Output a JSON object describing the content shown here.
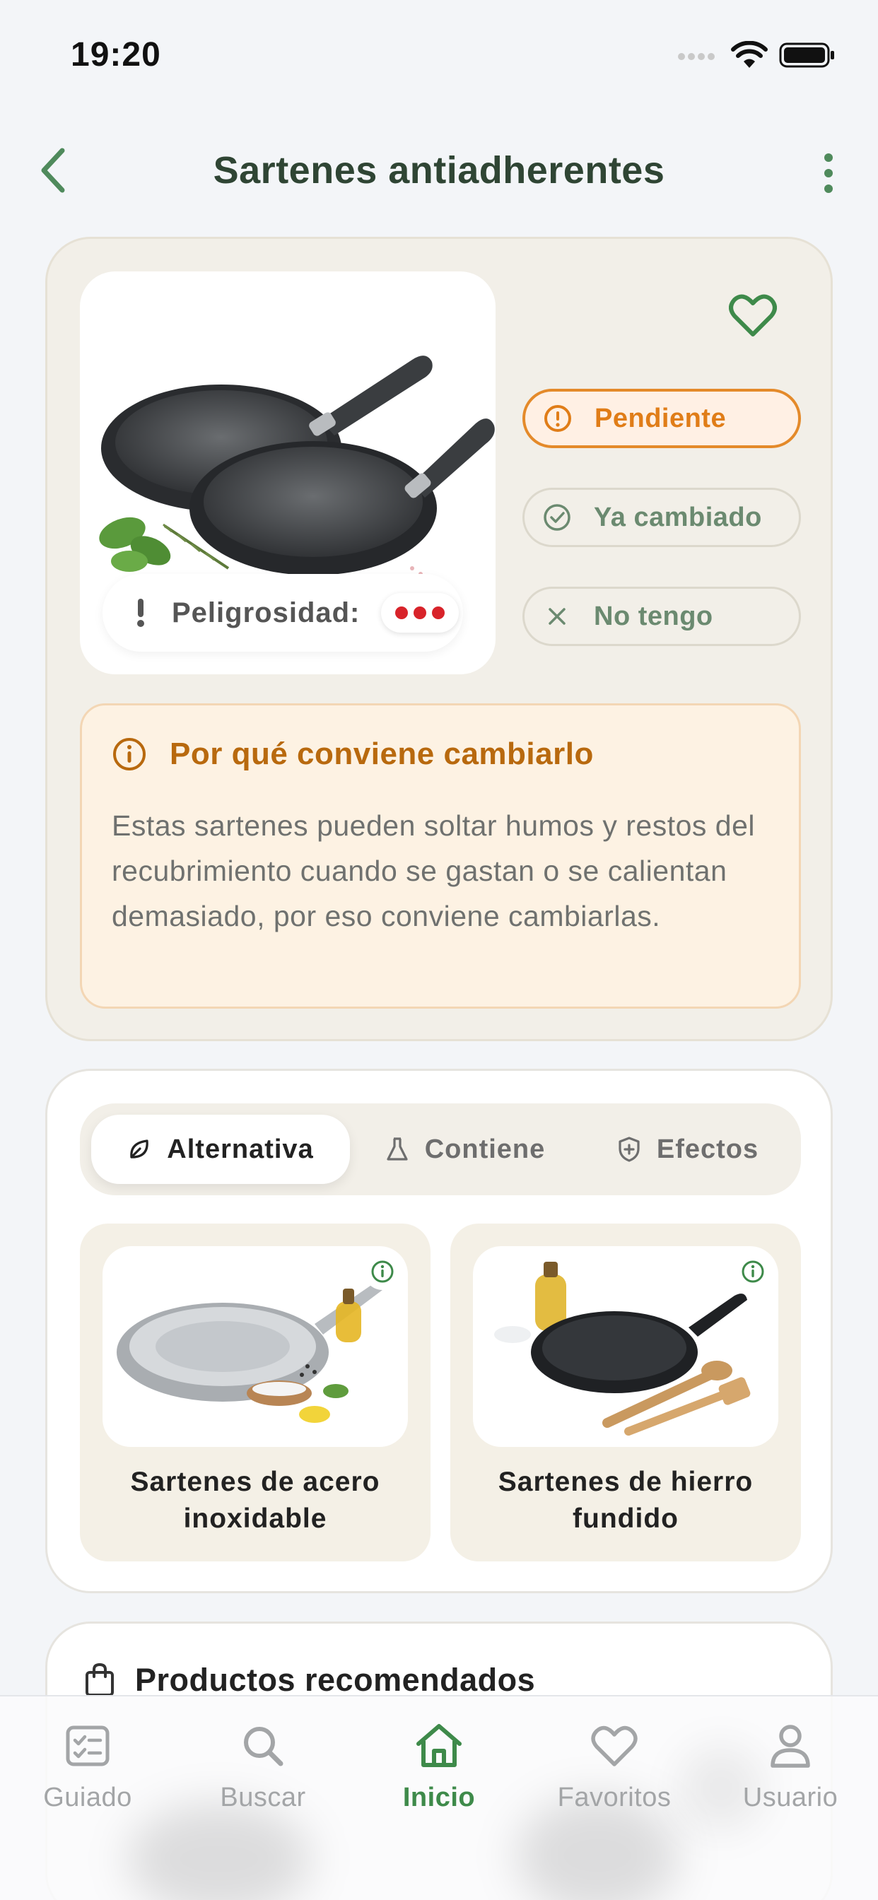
{
  "status_bar": {
    "time": "19:20"
  },
  "header": {
    "title": "Sartenes antiadherentes"
  },
  "product": {
    "danger_label": "Peligrosidad:",
    "danger_level": 3,
    "danger_max": 3,
    "status_options": [
      {
        "label": "Pendiente",
        "icon": "alert-circle-icon",
        "selected": true
      },
      {
        "label": "Ya cambiado",
        "icon": "check-circle-icon",
        "selected": false
      },
      {
        "label": "No tengo",
        "icon": "close-icon",
        "selected": false
      }
    ]
  },
  "why": {
    "title": "Por qué conviene cambiarlo",
    "text": "Estas sartenes pueden soltar humos y restos del recubrimiento cuando se gastan o se calientan demasiado, por eso conviene cambiarlas."
  },
  "tabs": [
    {
      "label": "Alternativa",
      "icon": "leaf-icon",
      "active": true
    },
    {
      "label": "Contiene",
      "icon": "flask-icon",
      "active": false
    },
    {
      "label": "Efectos",
      "icon": "shield-plus-icon",
      "active": false
    }
  ],
  "alternatives": [
    {
      "name": "Sartenes de acero inoxidable"
    },
    {
      "name": "Sartenes de hierro fundido"
    }
  ],
  "recommended": {
    "title": "Productos recomendados"
  },
  "bottom_nav": [
    {
      "label": "Guiado",
      "icon": "checklist-icon",
      "active": false
    },
    {
      "label": "Buscar",
      "icon": "search-icon",
      "active": false
    },
    {
      "label": "Inicio",
      "icon": "home-icon",
      "active": true
    },
    {
      "label": "Favoritos",
      "icon": "heart-icon",
      "active": false
    },
    {
      "label": "Usuario",
      "icon": "user-icon",
      "active": false
    }
  ],
  "colors": {
    "accent_green": "#3e8a4a",
    "pending_orange": "#e07d18",
    "danger_red": "#d8232a",
    "card_beige": "#f2efe8"
  }
}
